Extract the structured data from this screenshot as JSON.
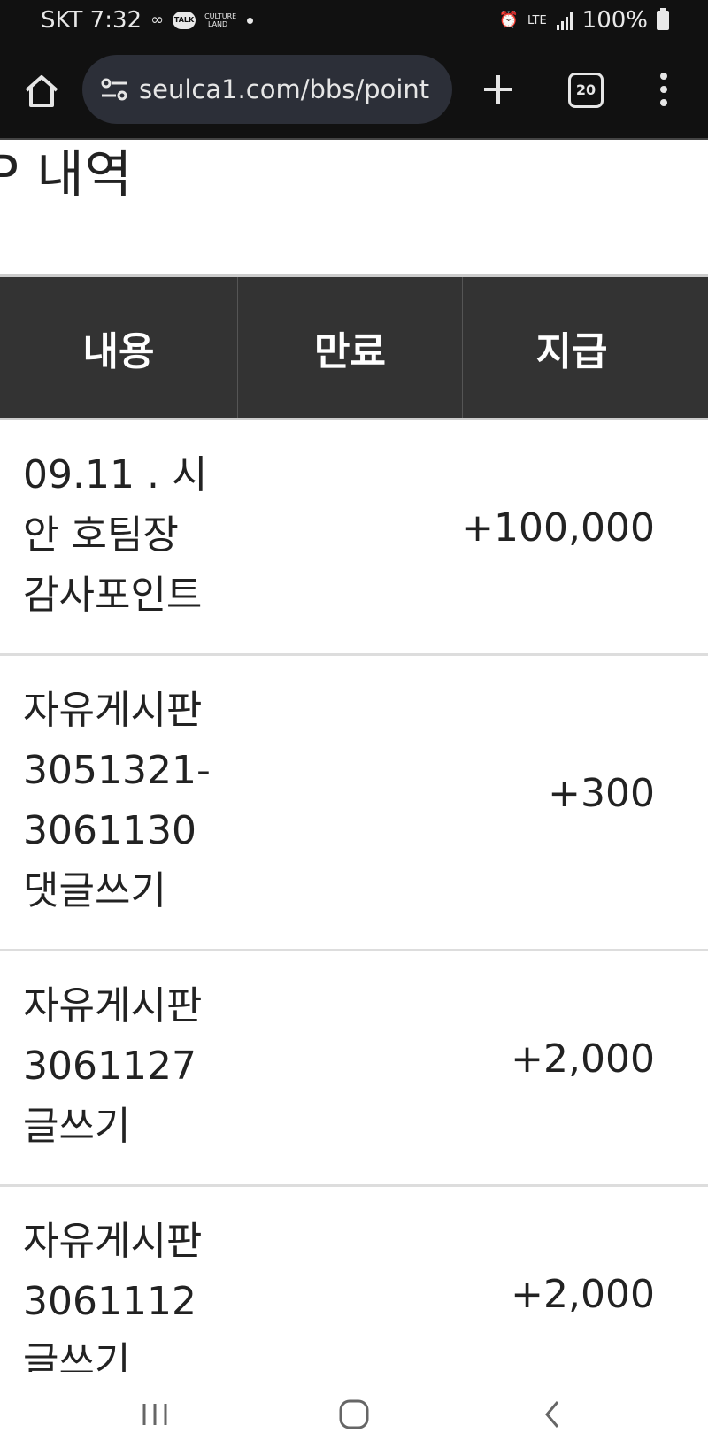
{
  "status_bar": {
    "carrier_time": "SKT 7:32",
    "talk_label": "TALK",
    "culture_label": "CULTURE LAND",
    "network": "LTE",
    "battery": "100%"
  },
  "browser": {
    "url": "seulca1.com/bbs/point",
    "tab_count": "20"
  },
  "page": {
    "heading": "P 내역"
  },
  "table": {
    "columns": [
      "내용",
      "만료",
      "지급",
      ""
    ],
    "rows": [
      {
        "content": "09.11 . 시안 호팀장 감사포인트",
        "expire": "",
        "amount": "+100,000"
      },
      {
        "content": "자유게시판 3051321-3061130 댓글쓰기",
        "expire": "",
        "amount": "+300"
      },
      {
        "content": "자유게시판 3061127 글쓰기",
        "expire": "",
        "amount": "+2,000"
      },
      {
        "content": "자유게시판 3061112 글쓰기",
        "expire": "",
        "amount": "+2,000"
      }
    ]
  },
  "colors": {
    "header_bg": "#333333",
    "status_bg": "#111111",
    "url_pill_bg": "#2c2f38"
  }
}
